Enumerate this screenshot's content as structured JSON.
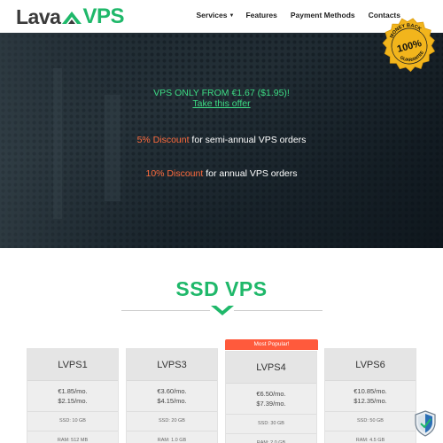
{
  "brand": {
    "name_part1": "Lava",
    "name_part2": "VPS",
    "accent": "#1fb86a"
  },
  "nav": {
    "services": "Services",
    "features": "Features",
    "payments": "Payment Methods",
    "contacts": "Contacts"
  },
  "hero": {
    "line1": "VPS ONLY FROM €1.67 ($1.95)!",
    "line1_link": "Take this offer",
    "discount1_highlight": "5% Discount",
    "discount1_rest": " for semi-annual VPS orders",
    "discount2_highlight": "10% Discount",
    "discount2_rest": " for annual VPS orders"
  },
  "badge": {
    "top": "MONEY BACK",
    "center": "100%",
    "bottom": "GUARANTEE"
  },
  "section": {
    "title": "SSD VPS"
  },
  "popular_label": "Most Popular!",
  "plans": [
    {
      "name": "LVPS1",
      "price_eur": "€1.85/mo.",
      "price_usd": "$2.15/mo.",
      "ssd": "SSD: 10 GB",
      "ram": "RAM: 512 MB"
    },
    {
      "name": "LVPS3",
      "price_eur": "€3.60/mo.",
      "price_usd": "$4.15/mo.",
      "ssd": "SSD: 20 GB",
      "ram": "RAM: 1.0 GB"
    },
    {
      "name": "LVPS4",
      "price_eur": "€6.50/mo.",
      "price_usd": "$7.39/mo.",
      "ssd": "SSD: 30 GB",
      "ram": "RAM: 2.0 GB"
    },
    {
      "name": "LVPS6",
      "price_eur": "€10.85/mo.",
      "price_usd": "$12.35/mo.",
      "ssd": "SSD: 50 GB",
      "ram": "RAM: 4.5 GB"
    }
  ],
  "icons": {
    "chevron": "chevron-down-icon",
    "shield": "shield-icon",
    "logo": "logo-mark-icon"
  },
  "colors": {
    "green": "#3ddc84",
    "orange": "#ff6b3d",
    "popular": "#ff5a3c"
  }
}
